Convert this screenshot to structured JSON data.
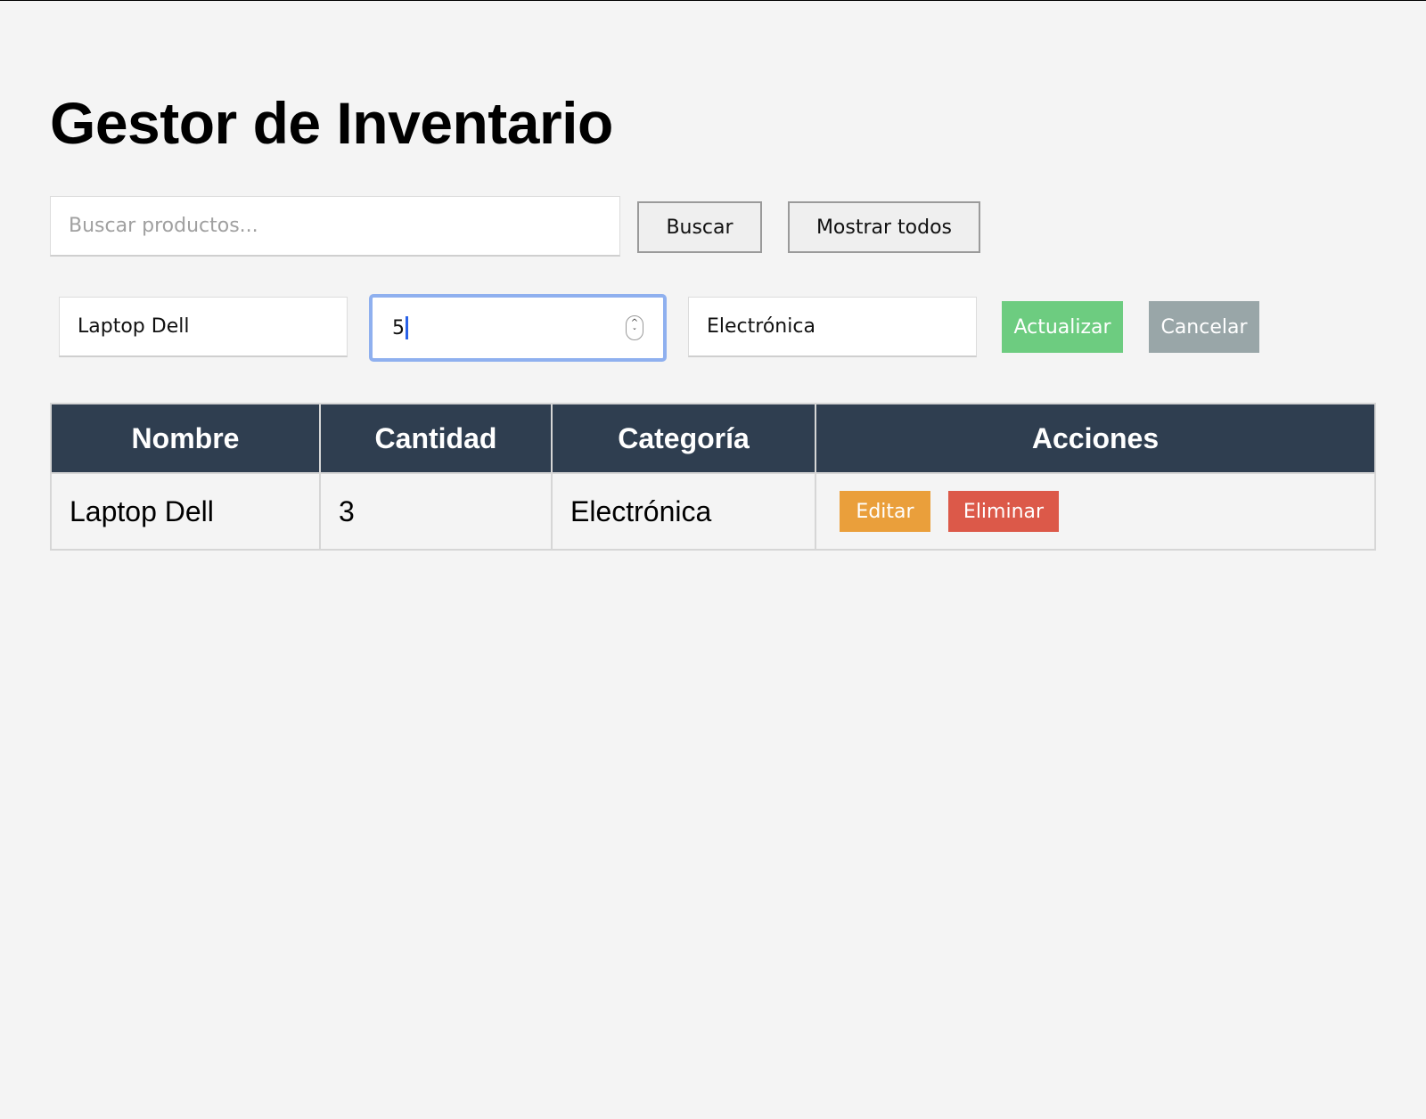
{
  "page": {
    "title": "Gestor de Inventario"
  },
  "search": {
    "placeholder": "Buscar productos...",
    "value": "",
    "search_button": "Buscar",
    "show_all_button": "Mostrar todos"
  },
  "edit_form": {
    "name_value": "Laptop Dell",
    "quantity_value": "5",
    "category_value": "Electrónica",
    "update_button": "Actualizar",
    "cancel_button": "Cancelar"
  },
  "table": {
    "headers": [
      "Nombre",
      "Cantidad",
      "Categoría",
      "Acciones"
    ],
    "rows": [
      {
        "name": "Laptop Dell",
        "quantity": "3",
        "category": "Electrónica",
        "edit_label": "Editar",
        "delete_label": "Eliminar"
      }
    ]
  },
  "colors": {
    "table_header_bg": "#2f3e50",
    "update_button": "#6dcc80",
    "cancel_button": "#99a6a8",
    "edit_button": "#ea9f3b",
    "delete_button": "#dc5949",
    "focus_ring": "#8fb0ef"
  },
  "icons": {
    "quantity_spinner": "stepper-up-down-icon"
  }
}
